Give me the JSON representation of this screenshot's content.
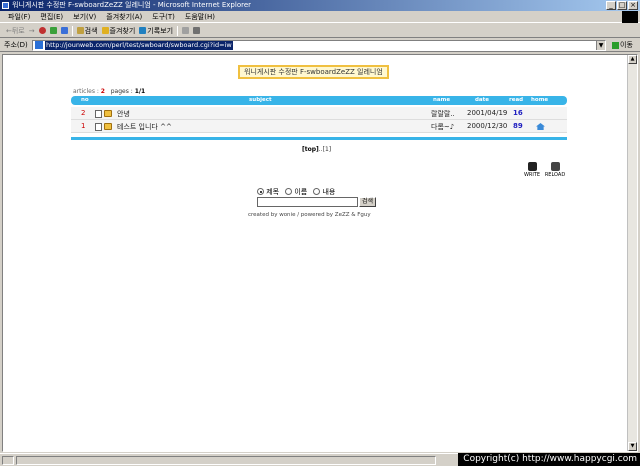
{
  "window": {
    "title": "워니게시판 수정판 F-swboardZeZZ 일레니엄 - Microsoft Internet Explorer"
  },
  "menu": [
    "파일(F)",
    "편집(E)",
    "보기(V)",
    "즐겨찾기(A)",
    "도구(T)",
    "도움말(H)"
  ],
  "toolbar": {
    "back": "←뒤로",
    "forward": "→",
    "search": "검색",
    "favorites": "즐겨찾기",
    "history": "기록보기"
  },
  "address": {
    "label": "주소(D)",
    "url": "http://jounweb.com/perl/test/swboard/swboard.cgi?id=iw",
    "go": "이동"
  },
  "board": {
    "title": "워니게시판 수정판 F-swboardZeZZ 일레니엄",
    "articles_label": "articles :",
    "articles_count": "2",
    "pages_label": "pages :",
    "pages_value": "1/1",
    "columns": {
      "no": "no",
      "subject": "subject",
      "name": "name",
      "date": "date",
      "read": "read",
      "home": "home"
    },
    "rows": [
      {
        "no": "2",
        "subject": "안녕",
        "name": "랄랄랄..",
        "date": "2001/04/19",
        "read": "16"
      },
      {
        "no": "1",
        "subject": "테스트 입니다 ^^",
        "name": "다롬~♪",
        "date": "2000/12/30",
        "read": "89"
      }
    ],
    "pager": {
      "top": "[top]",
      "sep": "..",
      "page": "[1]"
    },
    "write": "WRITE",
    "reload": "RELOAD",
    "search_options": [
      "제목",
      "이름",
      "내용"
    ],
    "search_button": "검색",
    "credit": "created by wonie / powered by ZeZZ & Fguy"
  },
  "watermark": "Copyright(c) http://www.happycgi.com"
}
